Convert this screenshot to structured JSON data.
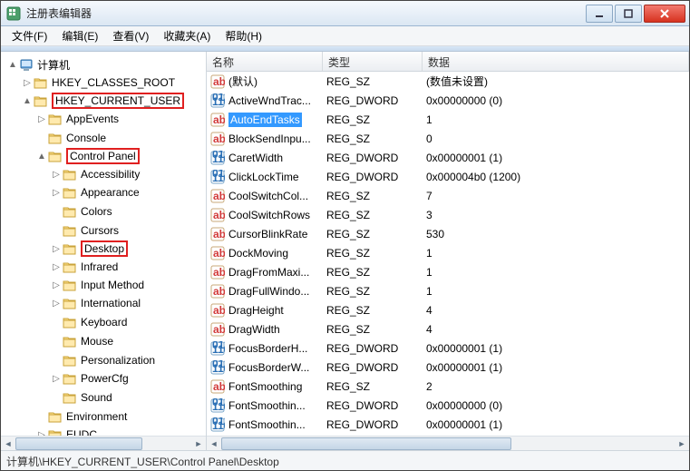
{
  "window": {
    "title": "注册表编辑器"
  },
  "menu": {
    "file": "文件(F)",
    "edit": "编辑(E)",
    "view": "查看(V)",
    "favorites": "收藏夹(A)",
    "help": "帮助(H)"
  },
  "tree": {
    "root": "计算机",
    "hkcr": "HKEY_CLASSES_ROOT",
    "hkcu": "HKEY_CURRENT_USER",
    "hkcu_children": {
      "appevents": "AppEvents",
      "console": "Console",
      "controlpanel": "Control Panel",
      "cp_children": {
        "accessibility": "Accessibility",
        "appearance": "Appearance",
        "colors": "Colors",
        "cursors": "Cursors",
        "desktop": "Desktop",
        "infrared": "Infrared",
        "inputmethod": "Input Method",
        "international": "International",
        "keyboard": "Keyboard",
        "mouse": "Mouse",
        "personalization": "Personalization",
        "powercfg": "PowerCfg",
        "sound": "Sound"
      },
      "environment": "Environment",
      "eudc": "EUDC"
    }
  },
  "list": {
    "col_name": "名称",
    "col_type": "类型",
    "col_data": "数据",
    "rows": [
      {
        "icon": "sz",
        "name": "(默认)",
        "type": "REG_SZ",
        "data": "(数值未设置)"
      },
      {
        "icon": "dw",
        "name": "ActiveWndTrac...",
        "type": "REG_DWORD",
        "data": "0x00000000 (0)"
      },
      {
        "icon": "sz",
        "name": "AutoEndTasks",
        "type": "REG_SZ",
        "data": "1",
        "selected": true
      },
      {
        "icon": "sz",
        "name": "BlockSendInpu...",
        "type": "REG_SZ",
        "data": "0"
      },
      {
        "icon": "dw",
        "name": "CaretWidth",
        "type": "REG_DWORD",
        "data": "0x00000001 (1)"
      },
      {
        "icon": "dw",
        "name": "ClickLockTime",
        "type": "REG_DWORD",
        "data": "0x000004b0 (1200)"
      },
      {
        "icon": "sz",
        "name": "CoolSwitchCol...",
        "type": "REG_SZ",
        "data": "7"
      },
      {
        "icon": "sz",
        "name": "CoolSwitchRows",
        "type": "REG_SZ",
        "data": "3"
      },
      {
        "icon": "sz",
        "name": "CursorBlinkRate",
        "type": "REG_SZ",
        "data": "530"
      },
      {
        "icon": "sz",
        "name": "DockMoving",
        "type": "REG_SZ",
        "data": "1"
      },
      {
        "icon": "sz",
        "name": "DragFromMaxi...",
        "type": "REG_SZ",
        "data": "1"
      },
      {
        "icon": "sz",
        "name": "DragFullWindo...",
        "type": "REG_SZ",
        "data": "1"
      },
      {
        "icon": "sz",
        "name": "DragHeight",
        "type": "REG_SZ",
        "data": "4"
      },
      {
        "icon": "sz",
        "name": "DragWidth",
        "type": "REG_SZ",
        "data": "4"
      },
      {
        "icon": "dw",
        "name": "FocusBorderH...",
        "type": "REG_DWORD",
        "data": "0x00000001 (1)"
      },
      {
        "icon": "dw",
        "name": "FocusBorderW...",
        "type": "REG_DWORD",
        "data": "0x00000001 (1)"
      },
      {
        "icon": "sz",
        "name": "FontSmoothing",
        "type": "REG_SZ",
        "data": "2"
      },
      {
        "icon": "dw",
        "name": "FontSmoothin...",
        "type": "REG_DWORD",
        "data": "0x00000000 (0)"
      },
      {
        "icon": "dw",
        "name": "FontSmoothin...",
        "type": "REG_DWORD",
        "data": "0x00000001 (1)"
      }
    ]
  },
  "status": {
    "path": "计算机\\HKEY_CURRENT_USER\\Control Panel\\Desktop"
  }
}
